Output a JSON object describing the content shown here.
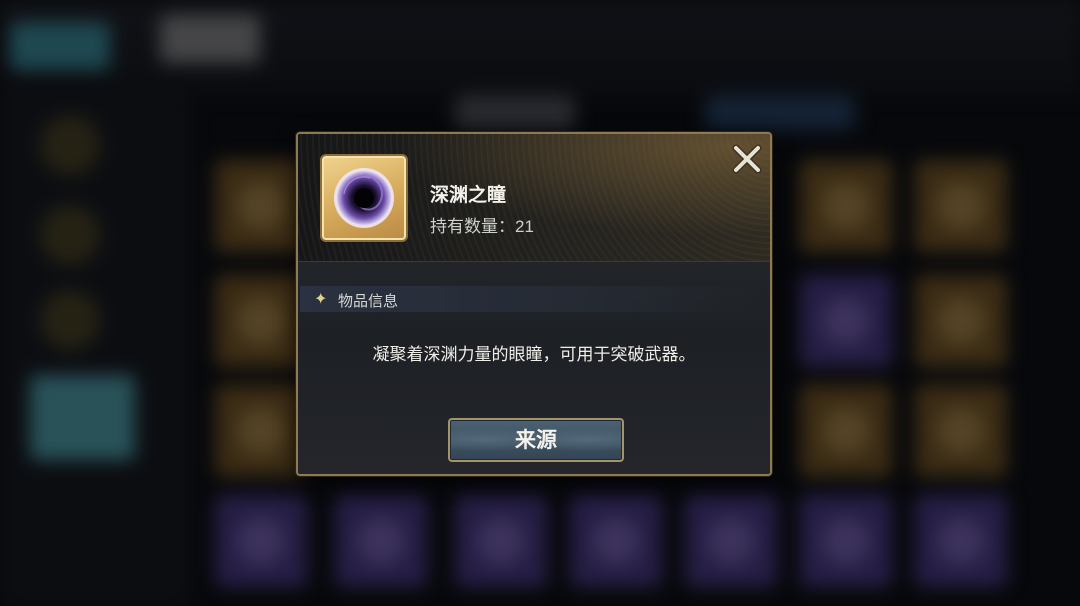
{
  "item": {
    "name": "深渊之瞳",
    "count_label": "持有数量：21",
    "icon": "abyss-eye-icon"
  },
  "section": {
    "label": "物品信息",
    "icon": "sparkle-icon"
  },
  "description": "凝聚着深渊力量的眼瞳，可用于突破武器。",
  "buttons": {
    "source_label": "来源",
    "close_icon": "close-icon"
  },
  "colors": {
    "frame_border": "#8d7a52",
    "icon_bg": "#e1bd72",
    "button_bg": "#3f5263",
    "star": "#e6cf8a"
  }
}
